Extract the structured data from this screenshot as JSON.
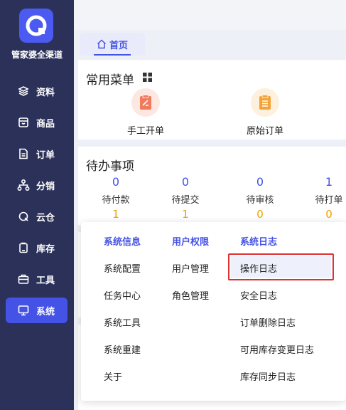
{
  "brand": {
    "name": "管家婆全渠道"
  },
  "sidebar": {
    "items": [
      {
        "label": "资料",
        "icon": "layers-icon"
      },
      {
        "label": "商品",
        "icon": "box-icon"
      },
      {
        "label": "订单",
        "icon": "document-icon"
      },
      {
        "label": "分销",
        "icon": "hierarchy-icon"
      },
      {
        "label": "云仓",
        "icon": "cloud-icon"
      },
      {
        "label": "库存",
        "icon": "clipboard-icon"
      },
      {
        "label": "工具",
        "icon": "toolbox-icon"
      },
      {
        "label": "系统",
        "icon": "monitor-icon",
        "active": true
      }
    ]
  },
  "tabs": {
    "home_label": "首页"
  },
  "common_menu": {
    "title": "常用菜单",
    "items": [
      {
        "label": "手工开单",
        "icon": "manual-order-icon",
        "color": "#f07a5e",
        "bg": "#fde7e1"
      },
      {
        "label": "原始订单",
        "icon": "original-order-icon",
        "color": "#f2a33a",
        "bg": "#fdf0dc"
      }
    ]
  },
  "todo": {
    "title": "待办事项",
    "items": [
      {
        "count": "0",
        "label": "待付款",
        "sub": "1"
      },
      {
        "count": "0",
        "label": "待提交",
        "sub": "1"
      },
      {
        "count": "0",
        "label": "待审核",
        "sub": "0"
      },
      {
        "count": "1",
        "label": "待打单",
        "sub": "0"
      }
    ]
  },
  "system_menu": {
    "columns": [
      {
        "header": "系统信息",
        "items": [
          "系统配置",
          "任务中心",
          "系统工具",
          "系统重建",
          "关于"
        ]
      },
      {
        "header": "用户权限",
        "items": [
          "用户管理",
          "角色管理"
        ]
      },
      {
        "header": "系统日志",
        "items": [
          "操作日志",
          "安全日志",
          "订单删除日志",
          "可用库存变更日志",
          "库存同步日志"
        ]
      }
    ],
    "highlighted": "操作日志"
  },
  "colors": {
    "sidebar": "#2c3159",
    "accent": "#4452e6",
    "highlight_border": "#e03030",
    "badge": "#f0a000"
  }
}
